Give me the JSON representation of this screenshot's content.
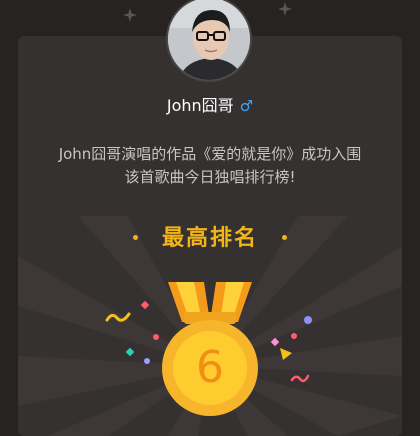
{
  "user": {
    "name": "John囧哥",
    "gender_symbol": "♂"
  },
  "description": {
    "line1": "John囧哥演唱的作品《爱的就是你》成功入围",
    "line2": "该首歌曲今日独唱排行榜!"
  },
  "rank": {
    "title": "最高排名",
    "value": "6"
  },
  "colors": {
    "accent": "#f3b414",
    "gender": "#3aa7ff",
    "card_bg": "#353130",
    "page_bg": "#262322"
  }
}
